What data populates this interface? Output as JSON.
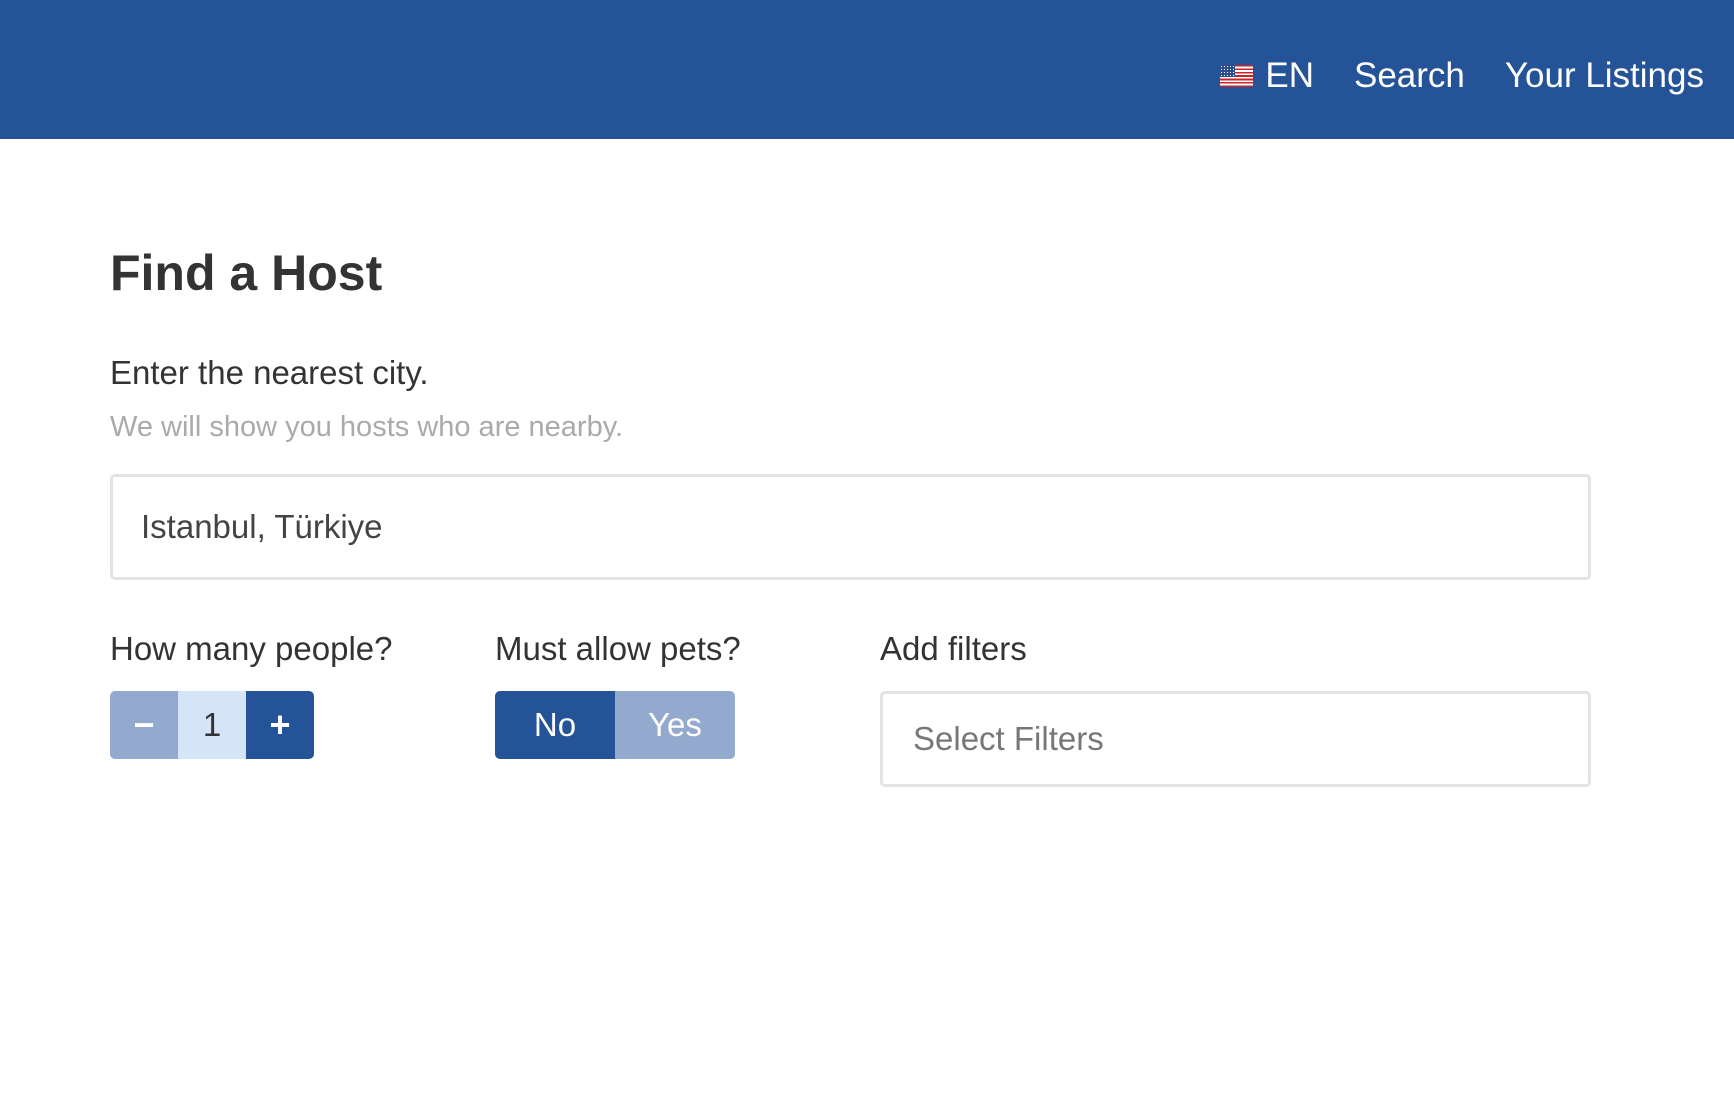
{
  "nav": {
    "language": {
      "flag_icon": "us-flag-icon",
      "label": "EN"
    },
    "search_label": "Search",
    "listings_label": "Your Listings",
    "background_color": "#255398"
  },
  "main": {
    "title": "Find a Host",
    "city": {
      "label": "Enter the nearest city.",
      "help": "We will show you hosts who are nearby.",
      "value": "Istanbul, Türkiye"
    },
    "people": {
      "label": "How many people?",
      "minus_icon": "minus-icon",
      "plus_icon": "plus-icon",
      "minus_symbol": "−",
      "plus_symbol": "+",
      "value": "1"
    },
    "pets": {
      "label": "Must allow pets?",
      "options": [
        "No",
        "Yes"
      ],
      "selected": "No"
    },
    "filters": {
      "label": "Add filters",
      "placeholder": "Select Filters"
    }
  },
  "colors": {
    "primary": "#255398",
    "primary_light": "#93aace",
    "stepper_value_bg": "#d6e4f8",
    "border": "#e3e3e3",
    "muted_text": "#aaaaaa"
  }
}
